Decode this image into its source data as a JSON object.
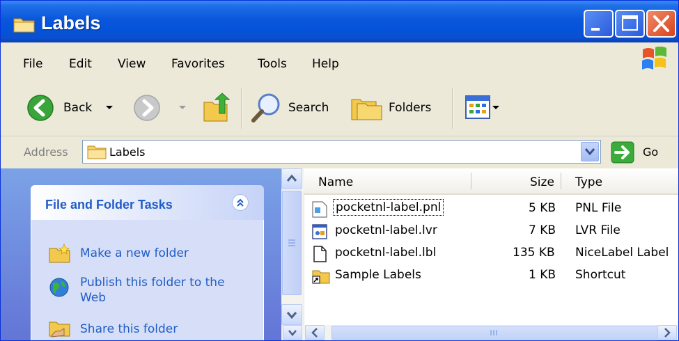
{
  "window": {
    "title": "Labels"
  },
  "menu": {
    "items": [
      "File",
      "Edit",
      "View",
      "Favorites",
      "Tools",
      "Help"
    ]
  },
  "toolbar": {
    "back_label": "Back",
    "search_label": "Search",
    "folders_label": "Folders"
  },
  "address": {
    "label": "Address",
    "value": "Labels",
    "go_label": "Go"
  },
  "tasks": {
    "title": "File and Folder Tasks",
    "items": [
      "Make a new folder",
      "Publish this folder to the Web",
      "Share this folder"
    ]
  },
  "files": {
    "columns": [
      "Name",
      "Size",
      "Type"
    ],
    "rows": [
      {
        "name": "pocketnl-label.pnl",
        "size": "5 KB",
        "type": "PNL File",
        "icon": "pnl-file-icon"
      },
      {
        "name": "pocketnl-label.lvr",
        "size": "7 KB",
        "type": "LVR File",
        "icon": "lvr-file-icon"
      },
      {
        "name": "pocketnl-label.lbl",
        "size": "135 KB",
        "type": "NiceLabel Label",
        "icon": "blank-file-icon"
      },
      {
        "name": "Sample Labels",
        "size": "1 KB",
        "type": "Shortcut",
        "icon": "shortcut-folder-icon"
      }
    ]
  },
  "colors": {
    "titlebar": "#0553d8",
    "task_link": "#215dc6",
    "pane": "#6375d6"
  }
}
